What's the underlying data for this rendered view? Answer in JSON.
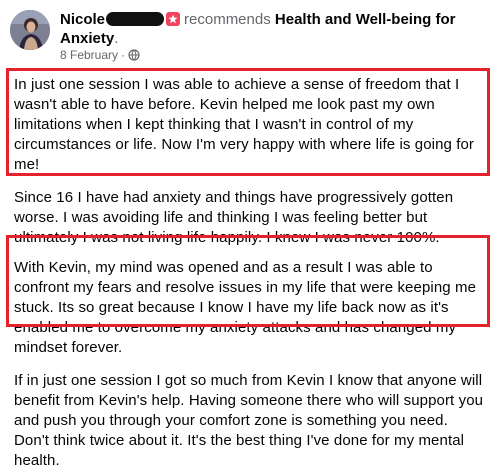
{
  "post": {
    "author": "Nicole",
    "recommends_text": "recommends",
    "page_name": "Health and Well-being for Anxiety",
    "page_name_suffix": ".",
    "date": "8 February",
    "dot": "·",
    "paragraphs": [
      "In just one session I was able to achieve a sense of freedom that I wasn't able to have before. Kevin helped me look past my own limitations when I kept thinking that I wasn't in control of my circumstances or life. Now I'm very happy with where life is going for me!",
      "Since 16 I have had anxiety and things have progressively gotten worse. I was avoiding life and thinking I was feeling better but ultimately I was not living life happily. I knew I was never 100%.",
      "With Kevin, my mind was opened and as a result I was able to confront my fears and resolve issues in my life that were keeping me stuck. Its so great because I know I have my life back now as it's enabled me to overcome my anxiety attacks and has changed my mindset forever.",
      "If in just one session I got so much from Kevin I know that anyone will benefit from Kevin's help. Having someone there who will support you and push you through your comfort zone is something you need. Don't think twice about it. It's the best thing I've done for my mental health."
    ],
    "icons": {
      "recommend": "recommend-star-icon",
      "audience": "globe-icon"
    }
  },
  "colors": {
    "highlight": "#e5212b",
    "recommend_badge": "#f3425f",
    "secondary_text": "#65676b"
  }
}
